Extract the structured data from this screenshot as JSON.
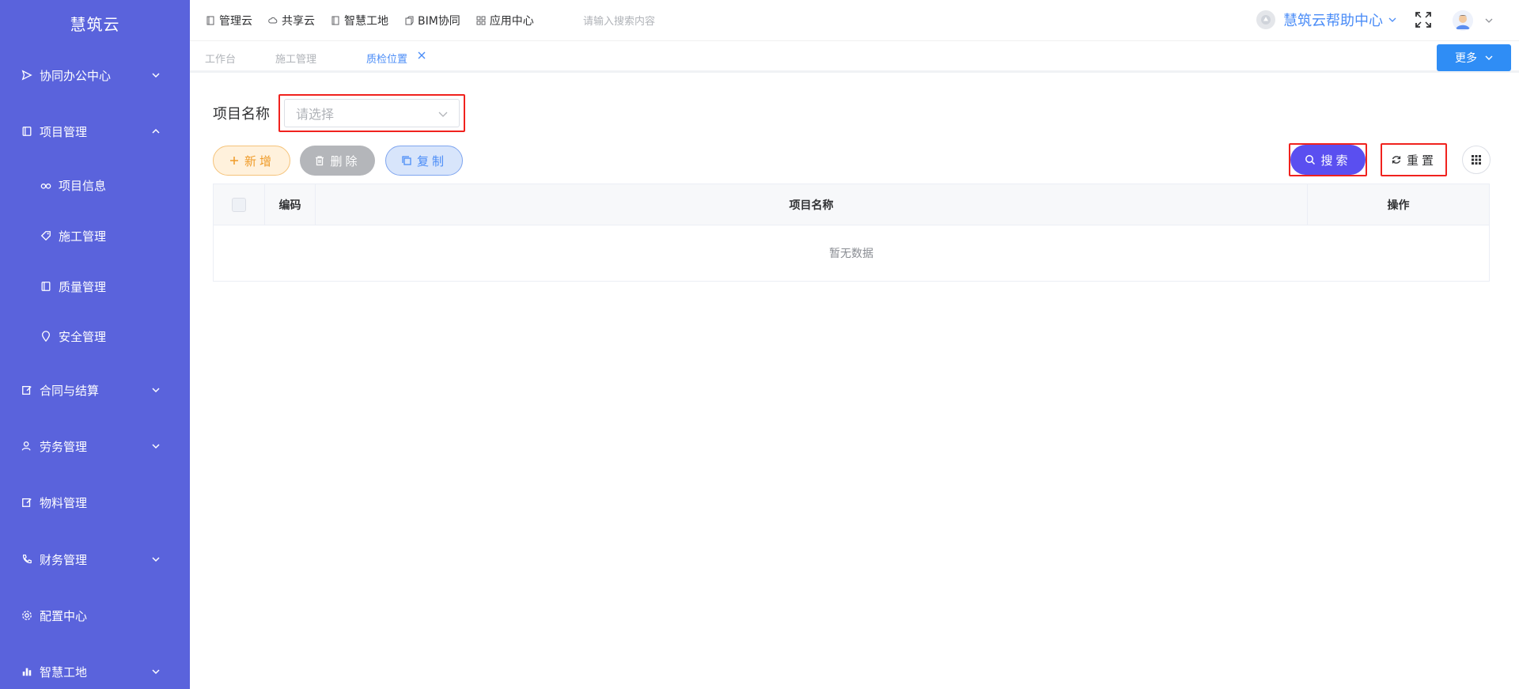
{
  "app": {
    "title": "慧筑云"
  },
  "sidebar": {
    "items": [
      {
        "label": "协同办公中心",
        "icon": "send-icon",
        "expandable": true,
        "expanded": false
      },
      {
        "label": "项目管理",
        "icon": "book-icon",
        "expandable": true,
        "expanded": true
      },
      {
        "label": "项目信息",
        "icon": "glasses-icon",
        "sub": true
      },
      {
        "label": "施工管理",
        "icon": "tag-icon",
        "sub": true
      },
      {
        "label": "质量管理",
        "icon": "book-icon",
        "sub": true
      },
      {
        "label": "安全管理",
        "icon": "location-icon",
        "sub": true
      },
      {
        "label": "合同与结算",
        "icon": "edit-icon",
        "expandable": true,
        "expanded": false
      },
      {
        "label": "劳务管理",
        "icon": "user-icon",
        "expandable": true,
        "expanded": false
      },
      {
        "label": "物料管理",
        "icon": "edit-icon",
        "expandable": false
      },
      {
        "label": "财务管理",
        "icon": "phone-icon",
        "expandable": true,
        "expanded": false
      },
      {
        "label": "配置中心",
        "icon": "gear-icon",
        "expandable": false
      },
      {
        "label": "智慧工地",
        "icon": "bar-chart-icon",
        "expandable": true,
        "expanded": false
      }
    ]
  },
  "header": {
    "nav": [
      {
        "label": "管理云",
        "icon": "doc-icon"
      },
      {
        "label": "共享云",
        "icon": "cloud-icon"
      },
      {
        "label": "智慧工地",
        "icon": "doc-icon"
      },
      {
        "label": "BIM协同",
        "icon": "cube-icon"
      },
      {
        "label": "应用中心",
        "icon": "grid-icon"
      }
    ],
    "search_placeholder": "请输入搜索内容",
    "help_label": "慧筑云帮助中心"
  },
  "tabs": {
    "items": [
      {
        "label": "工作台",
        "active": false
      },
      {
        "label": "施工管理",
        "active": false
      },
      {
        "label": "质检位置",
        "active": true
      }
    ],
    "more_label": "更多"
  },
  "form": {
    "project_label": "项目名称",
    "project_placeholder": "请选择"
  },
  "toolbar": {
    "add_label": "新增",
    "delete_label": "删除",
    "copy_label": "复制",
    "search_label": "搜索",
    "reset_label": "重置"
  },
  "table": {
    "columns": [
      "编码",
      "项目名称",
      "操作"
    ],
    "empty_text": "暂无数据"
  },
  "colors": {
    "sidebar_bg": "#5a63dc",
    "primary": "#4a8cf7",
    "search_btn": "#5a4ff0",
    "highlight": "#f0221e",
    "add_btn": "#ef9b28"
  }
}
